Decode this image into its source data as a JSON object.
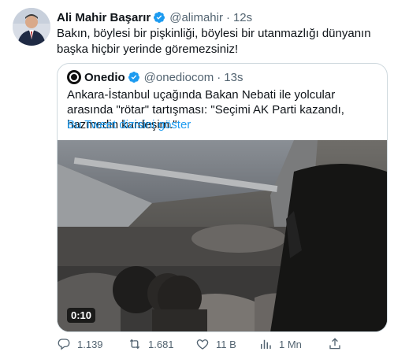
{
  "tweet": {
    "author_name": "Ali Mahir Başarır",
    "author_handle": "@alimahir",
    "separator": "·",
    "time": "12s",
    "text": "Bakın, böylesi bir pişkinliği, böylesi bir utanmazlığı dünyanın başka hiçbir yerinde göremezsiniz!"
  },
  "quote": {
    "author_name": "Onedio",
    "author_handle": "@onediocom",
    "separator": "·",
    "time": "13s",
    "text": "Ankara-İstanbul uçağında Bakan Nebati ile yolcular arasında \"rötar\" tartışması: \"Seçimi AK Parti kazandı, hazmedin kardeşim.\"",
    "thread_link": "Bu Tweet dizisini göster",
    "video_duration": "0:10"
  },
  "actions": {
    "replies": "1.139",
    "retweets": "1.681",
    "likes": "11 B",
    "views": "1 Mn"
  },
  "colors": {
    "accent": "#1d9bf0",
    "secondary_text": "#536471",
    "border": "#cfd9de",
    "verified": "#1d9bf0"
  }
}
